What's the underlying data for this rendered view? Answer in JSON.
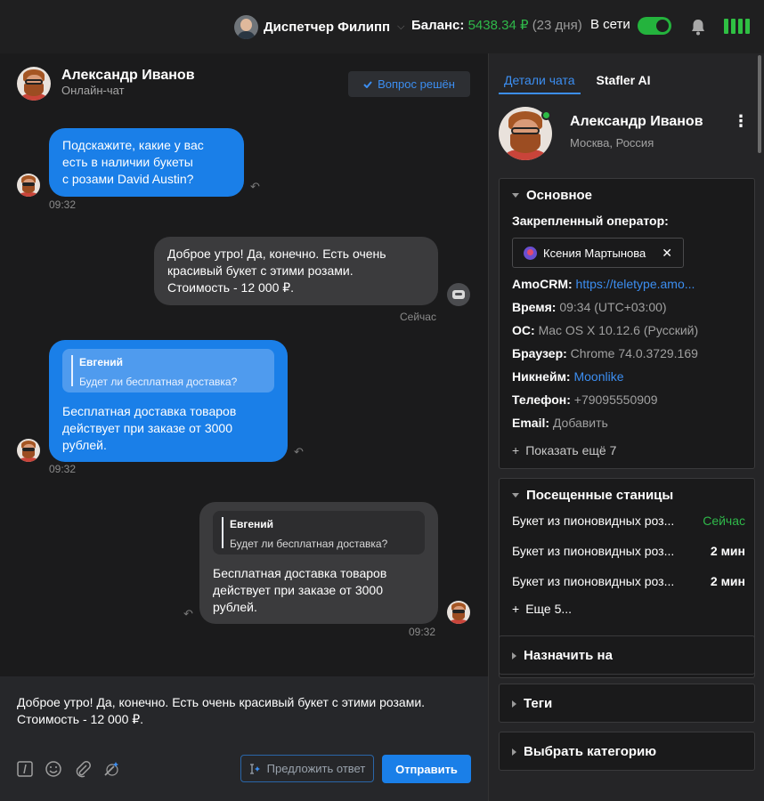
{
  "topbar": {
    "operator_name": "Диспетчер Филипп",
    "balance_label": "Баланс:",
    "balance_amount": "5438.34 ₽",
    "balance_days": "(23 дня)",
    "online_label": "В сети",
    "online": true,
    "accent": "#1a7fe8",
    "success": "#2fb84a"
  },
  "chat": {
    "contact_name": "Александр Иванов",
    "channel": "Онлайн-чат",
    "resolved_label": "Вопрос решён",
    "messages": [
      {
        "side": "in",
        "lines": [
          "Подскажите, какие у вас",
          "есть в наличии букеты",
          "с розами David Austin?"
        ],
        "time": "09:32"
      },
      {
        "side": "out",
        "lines": [
          "Доброе утро! Да, конечно. Есть очень",
          "красивый букет с этими розами.",
          "Стоимость - 12 000 ₽."
        ],
        "time": "Сейчас"
      },
      {
        "side": "in",
        "quote_name": "Евгений",
        "quote_text": "Будет ли бесплатная доставка?",
        "lines": [
          "Бесплатная доставка товаров",
          "действует при заказе от 3000",
          "рублей."
        ],
        "time": "09:32"
      },
      {
        "side": "out",
        "quote_name": "Евгений",
        "quote_text": "Будет ли бесплатная доставка?",
        "lines": [
          "Бесплатная доставка товаров",
          "действует при заказе от 3000",
          "рублей."
        ],
        "time": "09:32"
      }
    ]
  },
  "composer": {
    "text_line1": "Доброе утро! Да, конечно. Есть очень красивый букет с этими розами.",
    "text_line2": "Стоимость - 12 000 ₽.",
    "suggest_label": "Предложить ответ",
    "send_label": "Отправить"
  },
  "panel": {
    "tabs": [
      "Детали чата",
      "Stafler AI"
    ],
    "contact_name": "Александр Иванов",
    "location": "Москва, Россия",
    "main_section": {
      "title": "Основное",
      "assigned_label": "Закрепленный оператор:",
      "assigned_name": "Ксения Мартынова",
      "fields": [
        {
          "label": "AmoCRM:",
          "value": "https://teletype.amo...",
          "link": true
        },
        {
          "label": "Время:",
          "value": "09:34 (UTC+03:00)"
        },
        {
          "label": "ОС:",
          "value": "Mac OS X 10.12.6 (Русский)"
        },
        {
          "label": "Браузер:",
          "value": "Chrome 74.0.3729.169"
        },
        {
          "label": "Никнейм:",
          "value": "Moonlike",
          "link": true
        },
        {
          "label": "Телефон:",
          "value": "+79095550909"
        },
        {
          "label": "Email:",
          "value": "Добавить"
        }
      ],
      "show_more": "Показать ещё 7"
    },
    "pages_section": {
      "title": "Посещенные станицы",
      "items": [
        {
          "title": "Букет из пионовидных роз...",
          "time": "Сейчас"
        },
        {
          "title": "Букет из пионовидных роз...",
          "time": "2 мин"
        },
        {
          "title": "Букет из пионовидных роз...",
          "time": "2 мин"
        }
      ],
      "more": "Еще 5..."
    },
    "collapsed_sections": [
      "Назначить на",
      "Теги",
      "Выбрать категорию"
    ]
  }
}
